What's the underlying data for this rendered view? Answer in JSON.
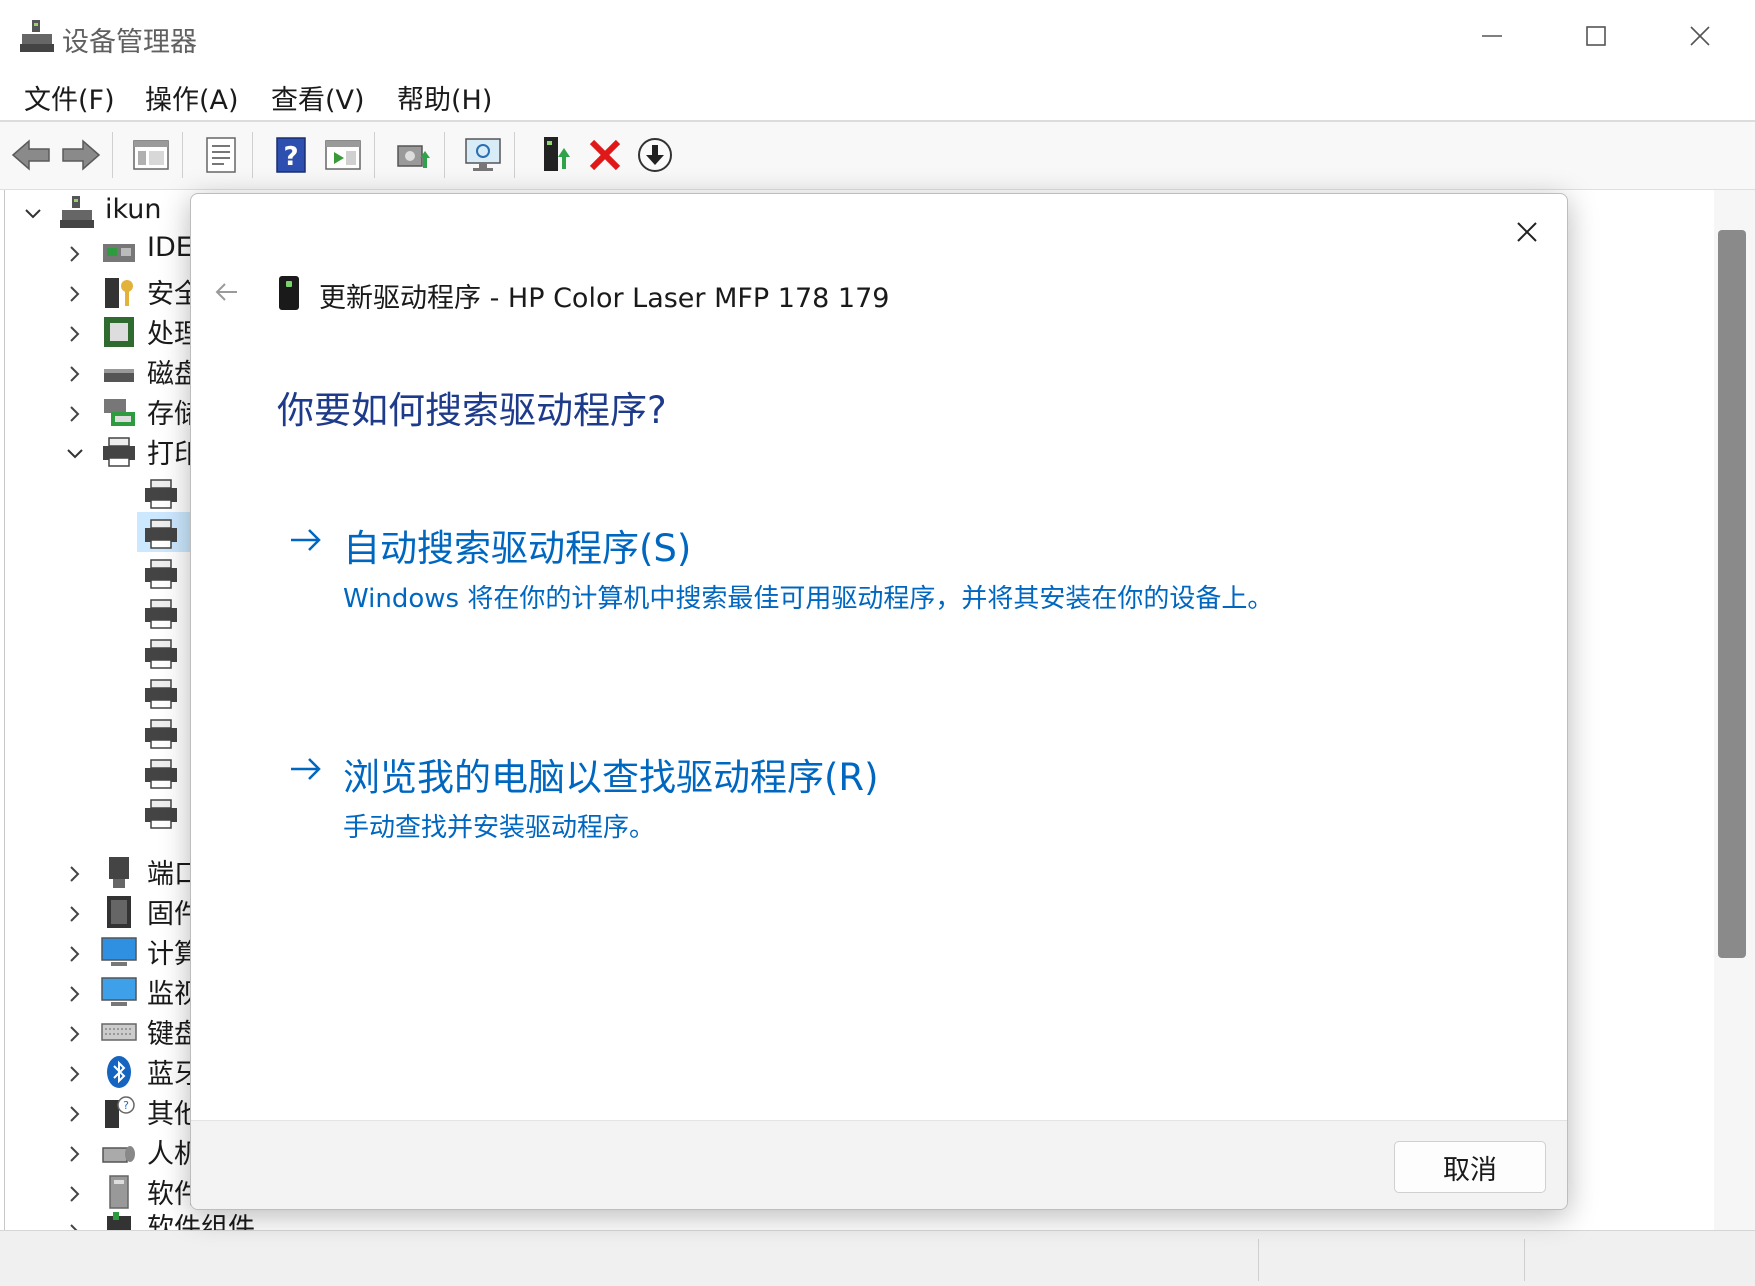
{
  "window": {
    "title": "设备管理器",
    "controls": {
      "minimize_icon": "minimize-icon",
      "maximize_icon": "maximize-icon",
      "close_icon": "close-icon"
    }
  },
  "menu": [
    "文件(F)",
    "操作(A)",
    "查看(V)",
    "帮助(H)"
  ],
  "toolbar": {
    "icons": [
      "back-arrow-icon",
      "forward-arrow-icon",
      "show-hide-tree-icon",
      "properties-icon",
      "help-icon",
      "view-icon",
      "scan-hardware-icon",
      "monitor-icon",
      "update-driver-icon",
      "uninstall-icon",
      "download-icon"
    ]
  },
  "tree": {
    "root": "ikun",
    "categories": [
      {
        "label": "IDE",
        "icon": "ide-controller-icon",
        "expanded": false
      },
      {
        "label": "安全",
        "icon": "security-key-icon",
        "expanded": false
      },
      {
        "label": "处理",
        "icon": "processor-icon",
        "expanded": false
      },
      {
        "label": "磁盘",
        "icon": "disk-drive-icon",
        "expanded": false
      },
      {
        "label": "存储",
        "icon": "storage-controller-icon",
        "expanded": false
      },
      {
        "label": "打印",
        "icon": "printer-icon",
        "expanded": true
      }
    ],
    "printer_children_count_label": "",
    "lower_categories": [
      {
        "label": "端口",
        "icon": "port-icon"
      },
      {
        "label": "固件",
        "icon": "firmware-icon"
      },
      {
        "label": "计算",
        "icon": "computer-icon"
      },
      {
        "label": "监视",
        "icon": "monitor-display-icon"
      },
      {
        "label": "键盘",
        "icon": "keyboard-icon"
      },
      {
        "label": "蓝牙",
        "icon": "bluetooth-icon"
      },
      {
        "label": "其他",
        "icon": "other-device-icon"
      },
      {
        "label": "人机",
        "icon": "hid-icon"
      },
      {
        "label": "软件",
        "icon": "software-device-icon"
      },
      {
        "label": "软件组件",
        "icon": "software-component-icon"
      }
    ]
  },
  "dialog": {
    "title": "更新驱动程序 - HP Color Laser MFP 178 179",
    "question": "你要如何搜索驱动程序?",
    "options": [
      {
        "title": "自动搜索驱动程序(S)",
        "description": "Windows 将在你的计算机中搜索最佳可用驱动程序，并将其安装在你的设备上。"
      },
      {
        "title": "浏览我的电脑以查找驱动程序(R)",
        "description": "手动查找并安装驱动程序。"
      }
    ],
    "cancel_label": "取消"
  },
  "colors": {
    "link_blue": "#0067c0",
    "heading_blue": "#1e3a8a",
    "selection": "#cce8ff"
  }
}
